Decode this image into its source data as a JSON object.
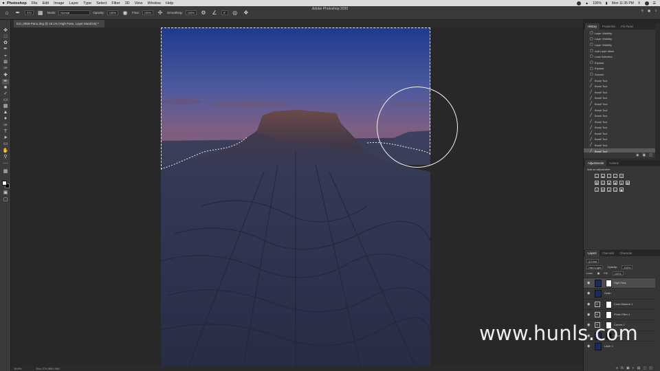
{
  "menubar": {
    "apple": "",
    "app": "Photoshop",
    "items": [
      "File",
      "Edit",
      "Image",
      "Layer",
      "Type",
      "Select",
      "Filter",
      "3D",
      "View",
      "Window",
      "Help"
    ],
    "battery": "100%",
    "clock": "Mon 11:35 PM"
  },
  "options": {
    "mode_label": "Mode:",
    "mode_value": "Normal",
    "opacity_label": "Opacity:",
    "opacity_value": "100%",
    "flow_label": "Flow:",
    "flow_value": "100%",
    "smoothing_label": "Smoothing:",
    "smoothing_value": "100%",
    "angle_value": "0°",
    "brush_size": "370",
    "app_title": "Adobe Photoshop 2020"
  },
  "document": {
    "tab_title": "DJI_0055-Pano.dng @ 19.1% (High Pass, Layer Mask/16) *"
  },
  "status": {
    "zoom": "16.9%",
    "doc_size": "Doc: 274.9M/1.06G"
  },
  "panels": {
    "history_tabs": [
      "History",
      "Properties",
      "Pin Panel"
    ],
    "history_items": [
      "Layer Visibility",
      "Layer Visibility",
      "Layer Visibility",
      "Add Layer Mask",
      "Load Selection",
      "Expand",
      "Expand",
      "Smooth",
      "Brush Tool",
      "Brush Tool",
      "Brush Tool",
      "Brush Tool",
      "Brush Tool",
      "Brush Tool",
      "Brush Tool",
      "Brush Tool",
      "Brush Tool",
      "Brush Tool",
      "Brush Tool",
      "Brush Tool",
      "Brush Tool"
    ],
    "adjust_tabs": [
      "Adjustments",
      "Actions"
    ],
    "adjust_hint": "Add an adjustment",
    "layers_tabs": [
      "Layers",
      "Channels",
      "Character"
    ],
    "kind_label": "Q Kind",
    "blend_mode": "Hard Light",
    "opacity_label": "Opacity:",
    "opacity_value": "100%",
    "lock_label": "Lock:",
    "fill_label": "Fill:",
    "fill_value": "100%",
    "layers": [
      {
        "name": "High Pass",
        "type": "pixel",
        "mask": "white",
        "selected": true
      },
      {
        "name": "Grain",
        "type": "pixel",
        "mask": "none",
        "selected": false
      },
      {
        "name": "Color Balance 1",
        "type": "adjust",
        "mask": "white",
        "selected": false
      },
      {
        "name": "Photo Filter 1",
        "type": "adjust",
        "mask": "white",
        "selected": false
      },
      {
        "name": "Curves 1",
        "type": "adjust",
        "mask": "white",
        "selected": false
      },
      {
        "name": "Glow",
        "type": "pixel",
        "mask": "dark",
        "selected": false
      },
      {
        "name": "Layer 1",
        "type": "pixel",
        "mask": "none",
        "selected": false
      }
    ]
  },
  "watermark": "www.hunls.com",
  "colors": {
    "sky_top": "#1f3a8c",
    "sky_mid": "#5a5a9a",
    "horizon": "#8a5a6a",
    "land": "#2f3550"
  }
}
